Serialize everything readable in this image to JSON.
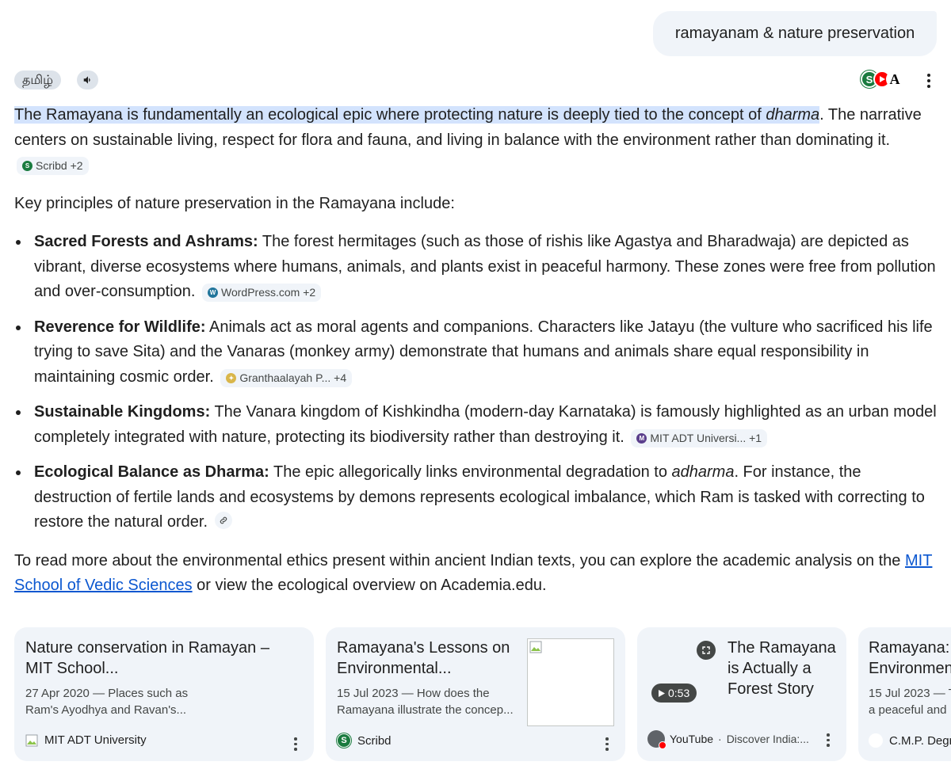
{
  "query": "ramayanam & nature preservation",
  "toolbar": {
    "lang_label": "தமிழ்",
    "scribd_letter": "S",
    "acad_letter": "A"
  },
  "answer": {
    "intro_highlight": "The Ramayana is fundamentally an ecological epic where protecting nature is deeply tied to the concept of ",
    "intro_highlight_em": "dharma",
    "intro_rest": ". The narrative centers on sustainable living, respect for flora and fauna, and living in balance with the environment rather than dominating it.",
    "intro_chip": "Scribd +2",
    "lead": "Key principles of nature preservation in the Ramayana include:",
    "points": [
      {
        "title": "Sacred Forests and Ashrams:",
        "text": " The forest hermitages (such as those of rishis like Agastya and Bharadwaja) are depicted as vibrant, diverse ecosystems where humans, animals, and plants exist in peaceful harmony. These zones were free from pollution and over-consumption.",
        "chip": "WordPress.com +2"
      },
      {
        "title": "Reverence for Wildlife:",
        "text": " Animals act as moral agents and companions. Characters like Jatayu (the vulture who sacrificed his life trying to save Sita) and the Vanaras (monkey army) demonstrate that humans and animals share equal responsibility in maintaining cosmic order.",
        "chip": "Granthaalayah P... +4"
      },
      {
        "title": "Sustainable Kingdoms:",
        "text": " The Vanara kingdom of Kishkindha (modern-day Karnataka) is famously highlighted as an urban model completely integrated with nature, protecting its biodiversity rather than destroying it.",
        "chip": "MIT ADT Universi... +1"
      },
      {
        "title": "Ecological Balance as Dharma:",
        "text_before": " The epic allegorically links environmental degradation to ",
        "text_em": "adharma",
        "text_after": ". For instance, the destruction of fertile lands and ecosystems by demons represents ecological imbalance, which Ram is tasked with correcting to restore the natural order."
      }
    ],
    "closing_before": "To read more about the environmental ethics present within ancient Indian texts, you can explore the academic analysis on the ",
    "closing_link": "MIT School of Vedic Sciences",
    "closing_after": " or view the ecological overview on Academia.edu."
  },
  "cards": [
    {
      "title": "Nature conservation in Ramayan – MIT School...",
      "snippet": "27 Apr 2020 — Places such as Ram's Ayodhya and Ravan's...",
      "source": "MIT ADT University"
    },
    {
      "title": "Ramayana's Lessons on Environmental...",
      "snippet": "15 Jul 2023 — How does the Ramayana illustrate the concep...",
      "source": "Scribd"
    },
    {
      "title": "The Ramayana is Actually a Forest Story",
      "duration": "0:53",
      "source": "YouTube",
      "channel": "Discover India:..."
    },
    {
      "title": "Ramayana: Environmen",
      "snippet": "15 Jul 2023 — T a peaceful and",
      "source": "C.M.P. Degr"
    }
  ],
  "colors": {
    "highlight": "#d3e3fd",
    "card_bg": "#f0f4f9",
    "link": "#0b57d0",
    "scribd_green": "#1a7b3f",
    "youtube_red": "#ff0000"
  }
}
